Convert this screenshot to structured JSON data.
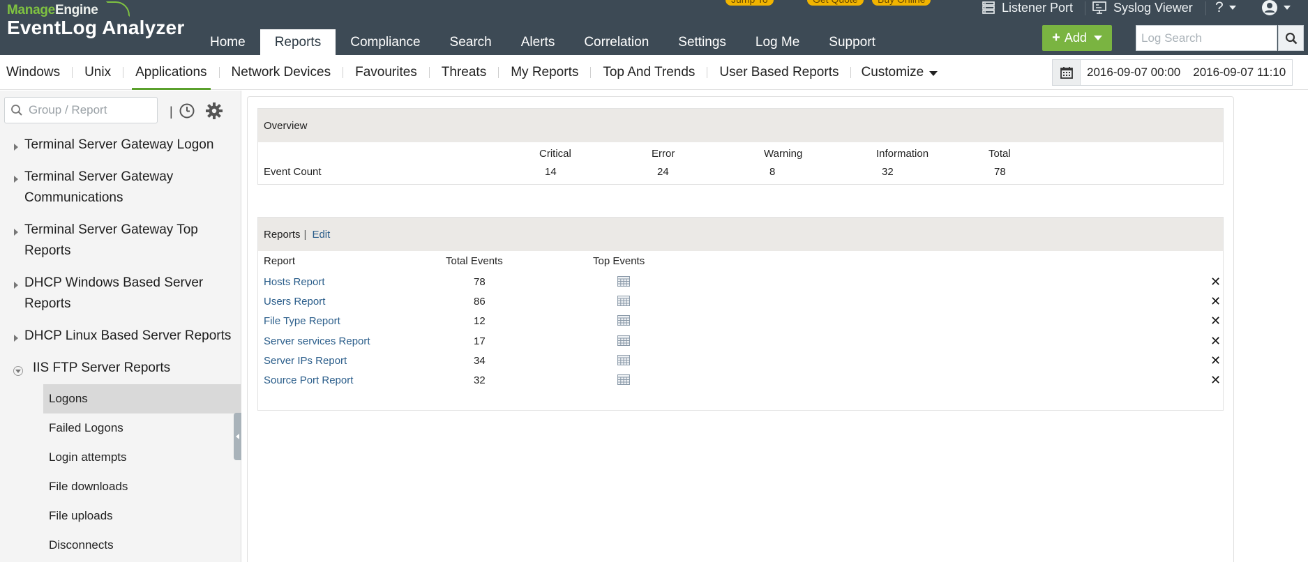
{
  "brand": {
    "company": "ManageEngine",
    "company_prefix": "Manage",
    "company_suffix": "Engine",
    "product": "EventLog Analyzer"
  },
  "header": {
    "jump_to": "Jump To",
    "get_quote": "Get Quote",
    "buy_online": "Buy Online",
    "listener_port": "Listener Port",
    "syslog_viewer": "Syslog Viewer",
    "help": "?",
    "add_label": "Add",
    "log_search_placeholder": "Log Search"
  },
  "main_nav": [
    "Home",
    "Reports",
    "Compliance",
    "Search",
    "Alerts",
    "Correlation",
    "Settings",
    "Log Me",
    "Support"
  ],
  "main_nav_active": "Reports",
  "sub_nav": [
    "Windows",
    "Unix",
    "Applications",
    "Network Devices",
    "Favourites",
    "Threats",
    "My Reports",
    "Top And Trends",
    "User Based Reports"
  ],
  "sub_nav_active": "Applications",
  "customize_label": "Customize",
  "date_range": {
    "from": "2016-09-07 00:00",
    "to": "2016-09-07 11:10"
  },
  "sidebar": {
    "search_placeholder": "Group / Report",
    "divider": "|",
    "groups": [
      "Terminal Server Gateway Logon",
      "Terminal Server Gateway Communications",
      "Terminal Server Gateway Top Reports",
      "DHCP Windows Based Server Reports",
      "DHCP Linux Based Server Reports"
    ],
    "open_group": "IIS FTP Server Reports",
    "open_children": [
      "Logons",
      "Failed Logons",
      "Login attempts",
      "File downloads",
      "File uploads",
      "Disconnects"
    ],
    "active_child": "Logons"
  },
  "overview": {
    "title": "Overview",
    "headers": [
      "Critical",
      "Error",
      "Warning",
      "Information",
      "Total"
    ],
    "row_label": "Event Count",
    "values": [
      "14",
      "24",
      "8",
      "32",
      "78"
    ]
  },
  "reports": {
    "title": "Reports",
    "divider": "|",
    "edit_label": "Edit",
    "col_report": "Report",
    "col_total": "Total Events",
    "col_top": "Top Events",
    "remove_glyph": "✕",
    "rows": [
      {
        "name": "Hosts Report",
        "total": "78"
      },
      {
        "name": "Users Report",
        "total": "86"
      },
      {
        "name": "File Type Report",
        "total": "12"
      },
      {
        "name": "Server services Report",
        "total": "17"
      },
      {
        "name": "Server IPs Report",
        "total": "34"
      },
      {
        "name": "Source Port Report",
        "total": "32"
      }
    ]
  },
  "colors": {
    "header_bg": "#3d4a55",
    "accent_green": "#7ab441",
    "pill": "#f1b400",
    "link": "#2a5d8a",
    "panel_head": "#ebe9e6"
  },
  "icons": {
    "listener_port": "server-icon",
    "syslog_viewer": "monitor-icon",
    "user": "user-icon",
    "search": "search-icon",
    "calendar": "calendar-icon",
    "history": "clock-icon",
    "settings": "gear-icon",
    "top_events": "table-grid-icon",
    "remove": "close-icon"
  }
}
